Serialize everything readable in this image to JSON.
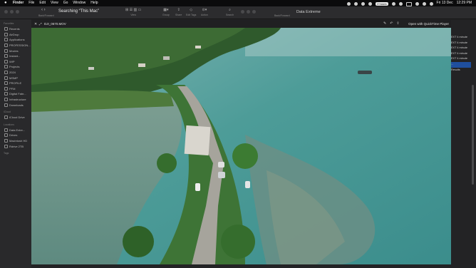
{
  "menubar": {
    "apple": "",
    "menus": [
      "Finder",
      "File",
      "Edit",
      "View",
      "Go",
      "Window",
      "Help"
    ],
    "status_pill": "2 hours",
    "date": "Fri 13 Dec",
    "time": "12:29 PM"
  },
  "toolbar": {
    "nav_arrows": "‹  ›",
    "nav_label": "Back/Forward",
    "search_title": "Searching “This Mac”",
    "groups": [
      {
        "glyph": "⊞ ☰ ▥ ▭",
        "label": "View"
      },
      {
        "glyph": "▦▾",
        "label": "Group"
      },
      {
        "glyph": "⇪",
        "label": "Share"
      },
      {
        "glyph": "◇",
        "label": "Edit Tags"
      },
      {
        "glyph": "⊙▾",
        "label": "Action"
      },
      {
        "glyph": "⌕",
        "label": "Search"
      }
    ],
    "second_title": "Data Extreme",
    "second_nav_label": "Back/Forward"
  },
  "sidebar": {
    "favorites_header": "Favorites",
    "favorites": [
      "Recents",
      "AirDrop",
      "Applications",
      "PROFESSION...",
      "Movies",
      "Instant...",
      "WIP",
      "Projects",
      "2024",
      "MSMP",
      "PROFILE",
      "PFM",
      "Digital Fabr...",
      "Infrastructure",
      "Downloads"
    ],
    "icloud_header": "iCloud",
    "icloud": [
      "iCloud Drive"
    ],
    "locations_header": "Locations",
    "locations": [
      "Data Extre...",
      "Drives",
      "Macintosh HD",
      "Rdrive 2TB"
    ],
    "tags_header": "Tags"
  },
  "right_list": [
    "EXT 4 minute",
    "EXT 4 minute",
    "EXT 4 minute",
    "EXT 4 minute",
    "EXT 4 minute",
    "...",
    "Results"
  ],
  "viewer": {
    "close_glyph": "✕",
    "fullscreen_glyph": "⤢",
    "filename": "DJI_0670.MOV",
    "tools": [
      "✎",
      "↶",
      "⇪"
    ],
    "open_with": "Open with QuickTime Player"
  }
}
